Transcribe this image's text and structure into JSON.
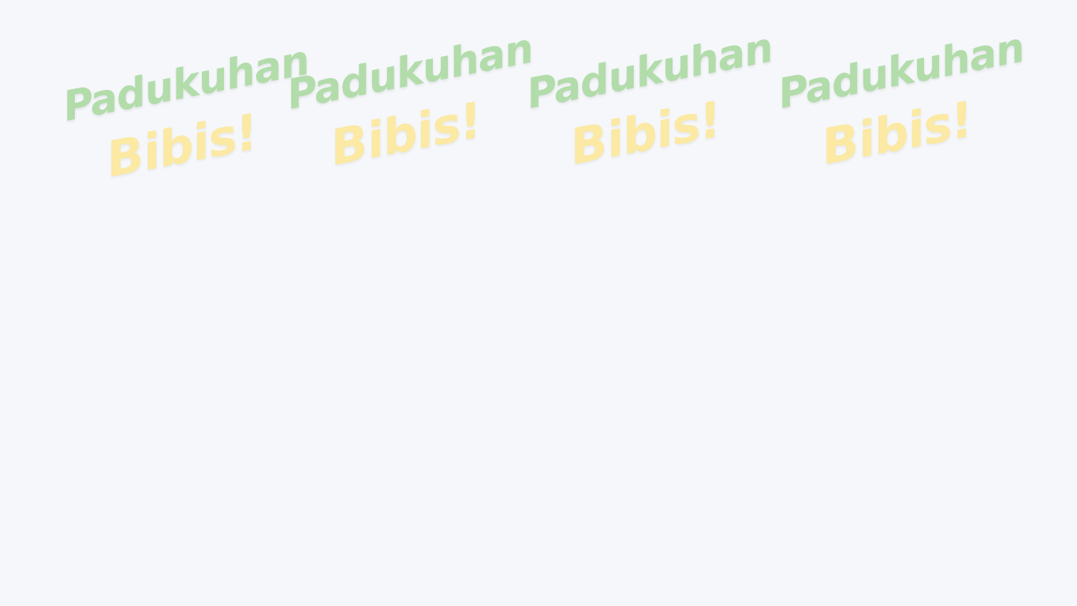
{
  "colors": {
    "background": "#f5f7fa",
    "logo_line_1": "#b2dcaa",
    "logo_line_2": "#fbe9a4"
  },
  "logos": [
    {
      "line_1": "Padukuhan",
      "line_2": "Bibis!"
    },
    {
      "line_1": "Padukuhan",
      "line_2": "Bibis!"
    },
    {
      "line_1": "Padukuhan",
      "line_2": "Bibis!"
    },
    {
      "line_1": "Padukuhan",
      "line_2": "Bibis!"
    }
  ]
}
